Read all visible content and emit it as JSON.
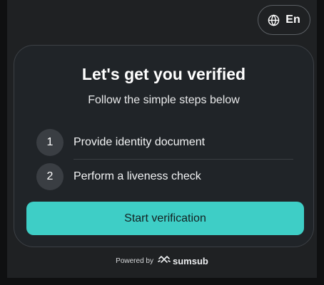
{
  "language": {
    "label": "En",
    "icon": "globe-icon"
  },
  "card": {
    "title": "Let's get you verified",
    "subtitle": "Follow the simple steps below",
    "steps": [
      {
        "number": "1",
        "label": "Provide identity document"
      },
      {
        "number": "2",
        "label": "Perform a liveness check"
      }
    ],
    "cta_label": "Start verification"
  },
  "footer": {
    "powered_by": "Powered by",
    "brand": "sumsub",
    "brand_icon": "sumsub-logo-icon"
  },
  "colors": {
    "background": "#0f1011",
    "panel": "#1f2123",
    "card": "#202428",
    "accent": "#3ecec6",
    "step_badge": "#3a3e43"
  }
}
